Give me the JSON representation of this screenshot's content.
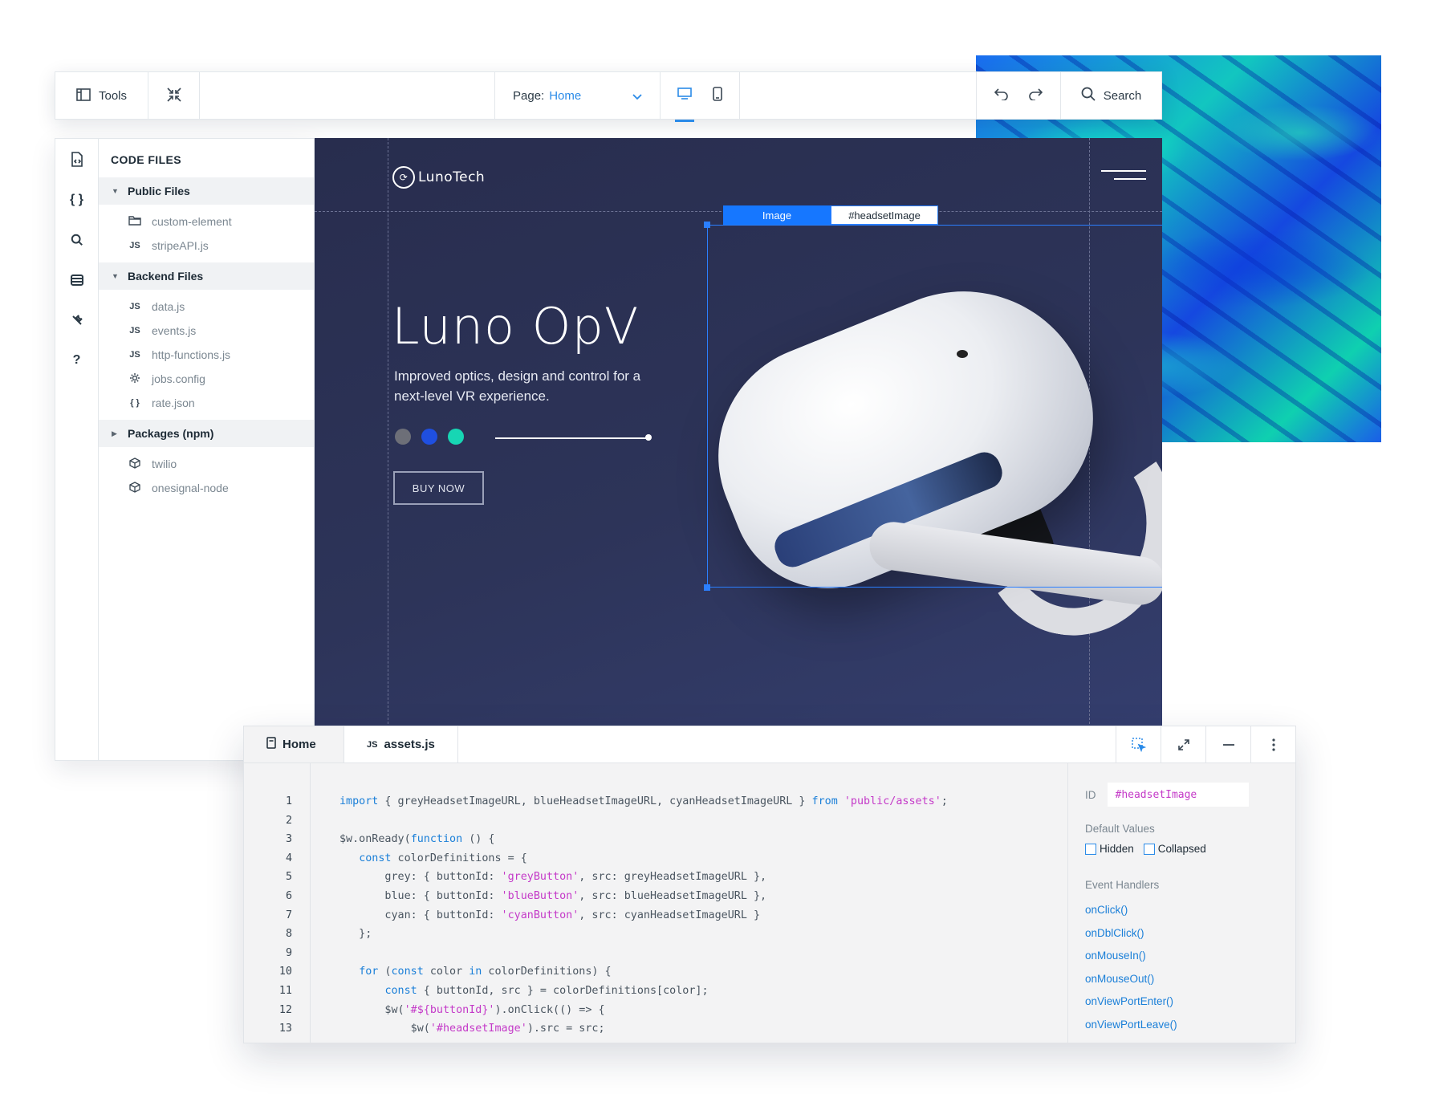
{
  "toolbar": {
    "tools_label": "Tools",
    "page_label": "Page:",
    "page_value": "Home",
    "search_label": "Search"
  },
  "sidebar": {
    "title": "CODE FILES",
    "groups": [
      {
        "label": "Public Files",
        "items": [
          {
            "icon": "folder-icon",
            "label": "custom-element"
          },
          {
            "icon": "js-file-icon",
            "label": "stripeAPI.js"
          }
        ]
      },
      {
        "label": "Backend Files",
        "items": [
          {
            "icon": "js-file-icon",
            "label": "data.js"
          },
          {
            "icon": "js-file-icon",
            "label": "events.js"
          },
          {
            "icon": "js-file-icon",
            "label": "http-functions.js"
          },
          {
            "icon": "gear-icon",
            "label": "jobs.config"
          },
          {
            "icon": "braces-icon",
            "label": "rate.json"
          }
        ]
      },
      {
        "label": "Packages (npm)",
        "items": [
          {
            "icon": "package-icon",
            "label": "twilio"
          },
          {
            "icon": "package-icon",
            "label": "onesignal-node"
          }
        ]
      }
    ],
    "js_glyph": "JS",
    "braces_glyph": "{ }"
  },
  "preview": {
    "brand": "LunoTech",
    "title": "Luno OpV",
    "subtitle": "Improved optics, design and control for a next-level VR experience.",
    "swatch_colors": [
      "#6d6f78",
      "#1f4fe0",
      "#17d6b4"
    ],
    "buy_label": "BUY NOW",
    "selection_type": "Image",
    "selection_id": "#headsetImage"
  },
  "editor": {
    "tabs": [
      {
        "label": "Home",
        "icon": "page-icon"
      },
      {
        "label": "assets.js",
        "icon": "js-file-icon"
      }
    ],
    "tab_js_glyph": "JS",
    "line_numbers": [
      "1",
      "2",
      "3",
      "4",
      "5",
      "6",
      "7",
      "8",
      "9",
      "10",
      "11",
      "12",
      "13"
    ],
    "properties": {
      "id_label": "ID",
      "id_value": "#headsetImage",
      "default_values_label": "Default Values",
      "hidden_label": "Hidden",
      "collapsed_label": "Collapsed",
      "event_handlers_label": "Event Handlers",
      "handlers": [
        "onClick()",
        "onDblClick()",
        "onMouseIn()",
        "onMouseOut()",
        "onViewPortEnter()",
        "onViewPortLeave()"
      ]
    }
  },
  "code_lines": [
    [
      {
        "t": "import",
        "c": "kw"
      },
      {
        "t": " { greyHeadsetImageURL, blueHeadsetImageURL, cyanHeadsetImageURL } "
      },
      {
        "t": "from",
        "c": "kw"
      },
      {
        "t": " "
      },
      {
        "t": "'public/assets'",
        "c": "str"
      },
      {
        "t": ";"
      }
    ],
    [],
    [
      {
        "t": "$w.onReady("
      },
      {
        "t": "function",
        "c": "kw"
      },
      {
        "t": " () {"
      }
    ],
    [
      {
        "t": "   "
      },
      {
        "t": "const",
        "c": "kw"
      },
      {
        "t": " colorDefinitions = {"
      }
    ],
    [
      {
        "t": "       grey: { buttonId: "
      },
      {
        "t": "'greyButton'",
        "c": "str"
      },
      {
        "t": ", src: greyHeadsetImageURL },"
      }
    ],
    [
      {
        "t": "       blue: { buttonId: "
      },
      {
        "t": "'blueButton'",
        "c": "str"
      },
      {
        "t": ", src: blueHeadsetImageURL },"
      }
    ],
    [
      {
        "t": "       cyan: { buttonId: "
      },
      {
        "t": "'cyanButton'",
        "c": "str"
      },
      {
        "t": ", src: cyanHeadsetImageURL }"
      }
    ],
    [
      {
        "t": "   };"
      }
    ],
    [],
    [
      {
        "t": "   "
      },
      {
        "t": "for",
        "c": "kw"
      },
      {
        "t": " ("
      },
      {
        "t": "const",
        "c": "kw"
      },
      {
        "t": " color "
      },
      {
        "t": "in",
        "c": "kw"
      },
      {
        "t": " colorDefinitions) {"
      }
    ],
    [
      {
        "t": "       "
      },
      {
        "t": "const",
        "c": "kw"
      },
      {
        "t": " { buttonId, src } = colorDefinitions[color];"
      }
    ],
    [
      {
        "t": "       $w("
      },
      {
        "t": "'#${buttonId}'",
        "c": "str"
      },
      {
        "t": ").onClick(() => {"
      }
    ],
    [
      {
        "t": "           $w("
      },
      {
        "t": "'#headsetImage'",
        "c": "str"
      },
      {
        "t": ").src = src;"
      }
    ]
  ]
}
